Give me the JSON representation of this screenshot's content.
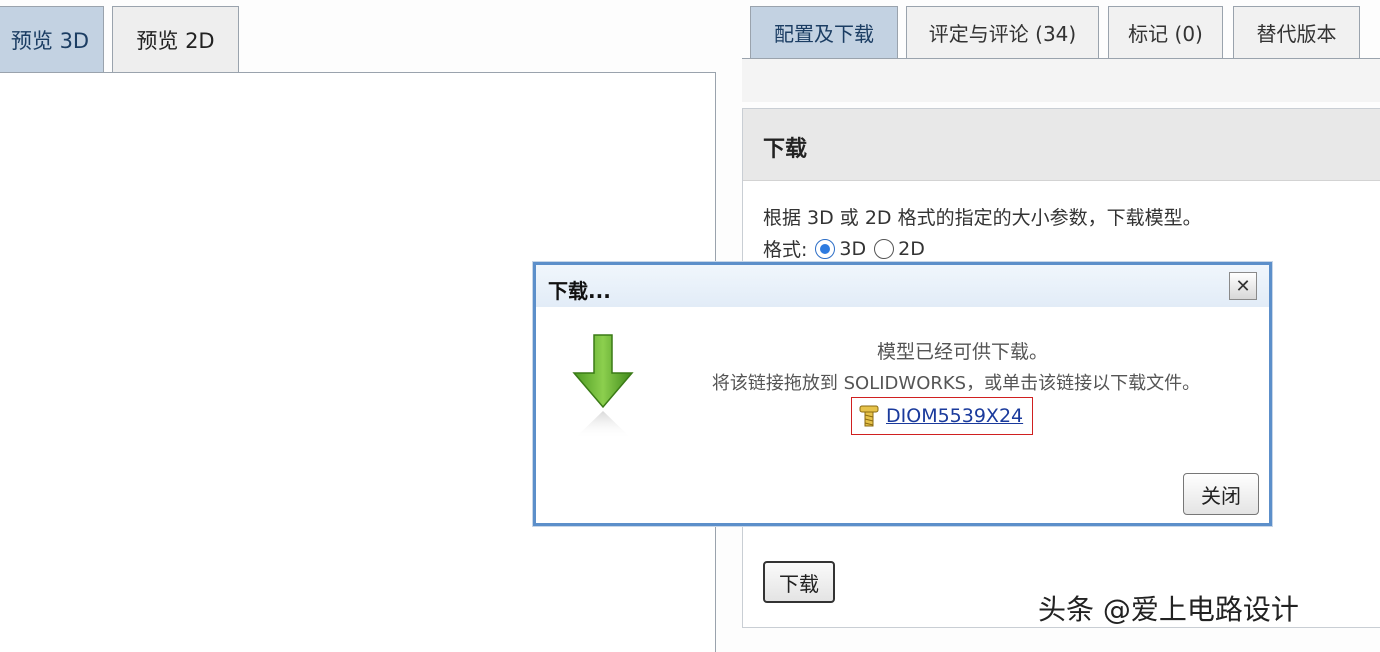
{
  "preview_tabs": {
    "tab_3d": "预览 3D",
    "tab_2d": "预览 2D"
  },
  "right_tabs": {
    "config": "配置及下载",
    "reviews": "评定与评论 (34)",
    "tags": "标记 (0)",
    "alternates": "替代版本"
  },
  "download_panel": {
    "header": "下载",
    "description": "根据 3D 或 2D 格式的指定的大小参数，下载模型。",
    "format_label": "格式:",
    "format_options": [
      "3D",
      "2D"
    ],
    "format_selected": "3D",
    "download_button": "下载"
  },
  "dialog": {
    "title": "下载...",
    "close_x": "✕",
    "message": "模型已经可供下载。",
    "instruction": "将该链接拖放到 SOLIDWORKS，或单击该链接以下载文件。",
    "file_link": "DIOM5539X24",
    "close_button": "关闭",
    "colors": {
      "border": "#5c8fca",
      "link": "#1a3a9c",
      "highlight_box": "#d02020",
      "arrow_green": "#5fae2e"
    }
  },
  "watermark": "头条 @爱上电路设计"
}
